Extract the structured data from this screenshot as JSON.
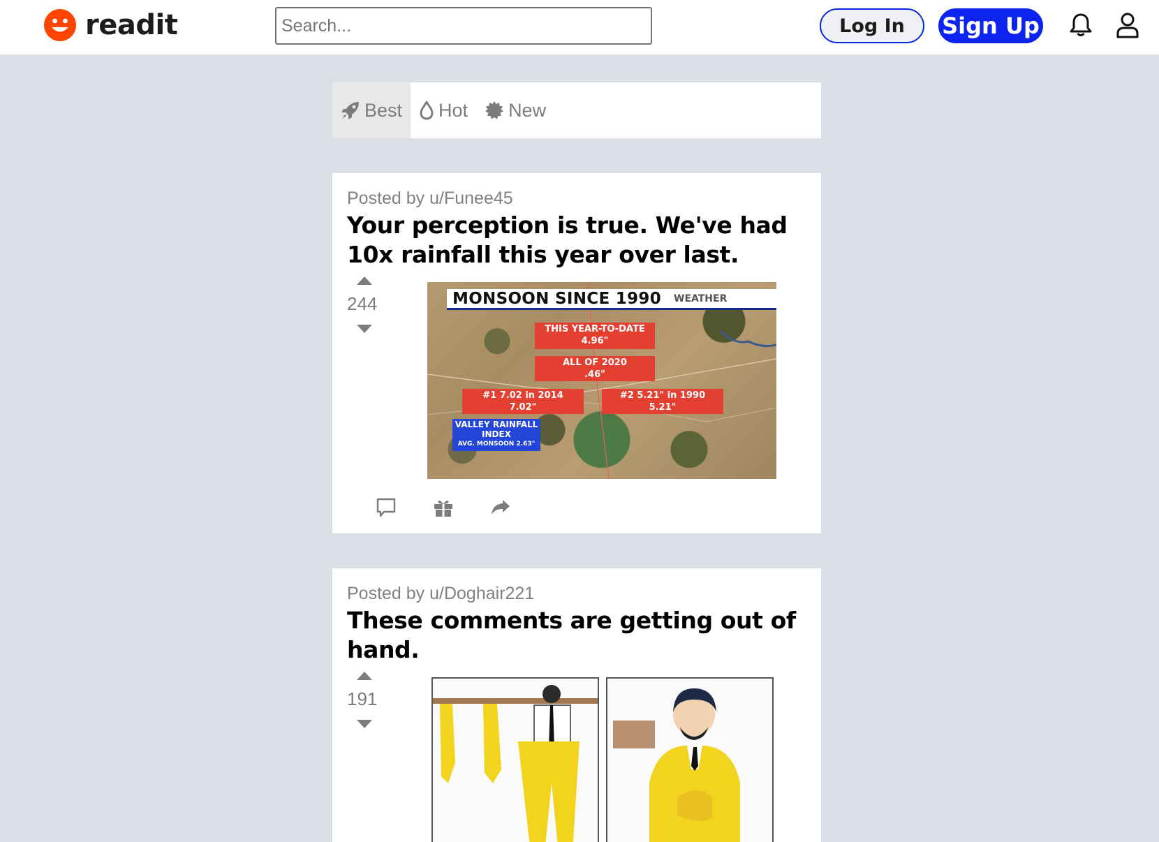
{
  "header": {
    "brand": "readit",
    "search_placeholder": "Search...",
    "login_label": "Log In",
    "signup_label": "Sign Up",
    "accent_color": "#0d23f0",
    "logo_color": "#ff4500"
  },
  "sort": {
    "tabs": [
      {
        "label": "Best",
        "icon": "rocket-icon",
        "active": true
      },
      {
        "label": "Hot",
        "icon": "flame-icon",
        "active": false
      },
      {
        "label": "New",
        "icon": "burst-icon",
        "active": false
      }
    ]
  },
  "posts": [
    {
      "meta": "Posted by u/Funee45",
      "title": "Your perception is true. We've had 10x rainfall this year over last.",
      "votes": "244",
      "image": {
        "banner_title": "MONSOON SINCE 1990",
        "banner_brand": "WEATHER",
        "labels": [
          {
            "line1": "THIS YEAR-TO-DATE",
            "line2": "4.96\""
          },
          {
            "line1": "ALL OF 2020",
            "line2": ".46\""
          },
          {
            "line1": "#1 7.02 in 2014",
            "line2": "7.02\""
          },
          {
            "line1": "#2 5.21\" in 1990",
            "line2": "5.21\""
          }
        ],
        "index_box": {
          "line1": "VALLEY RAINFALL",
          "line2": "INDEX",
          "line3": "AVG. MONSOON 2.63\""
        }
      }
    },
    {
      "meta": "Posted by u/Doghair221",
      "title": "These comments are getting out of hand.",
      "votes": "191"
    }
  ]
}
